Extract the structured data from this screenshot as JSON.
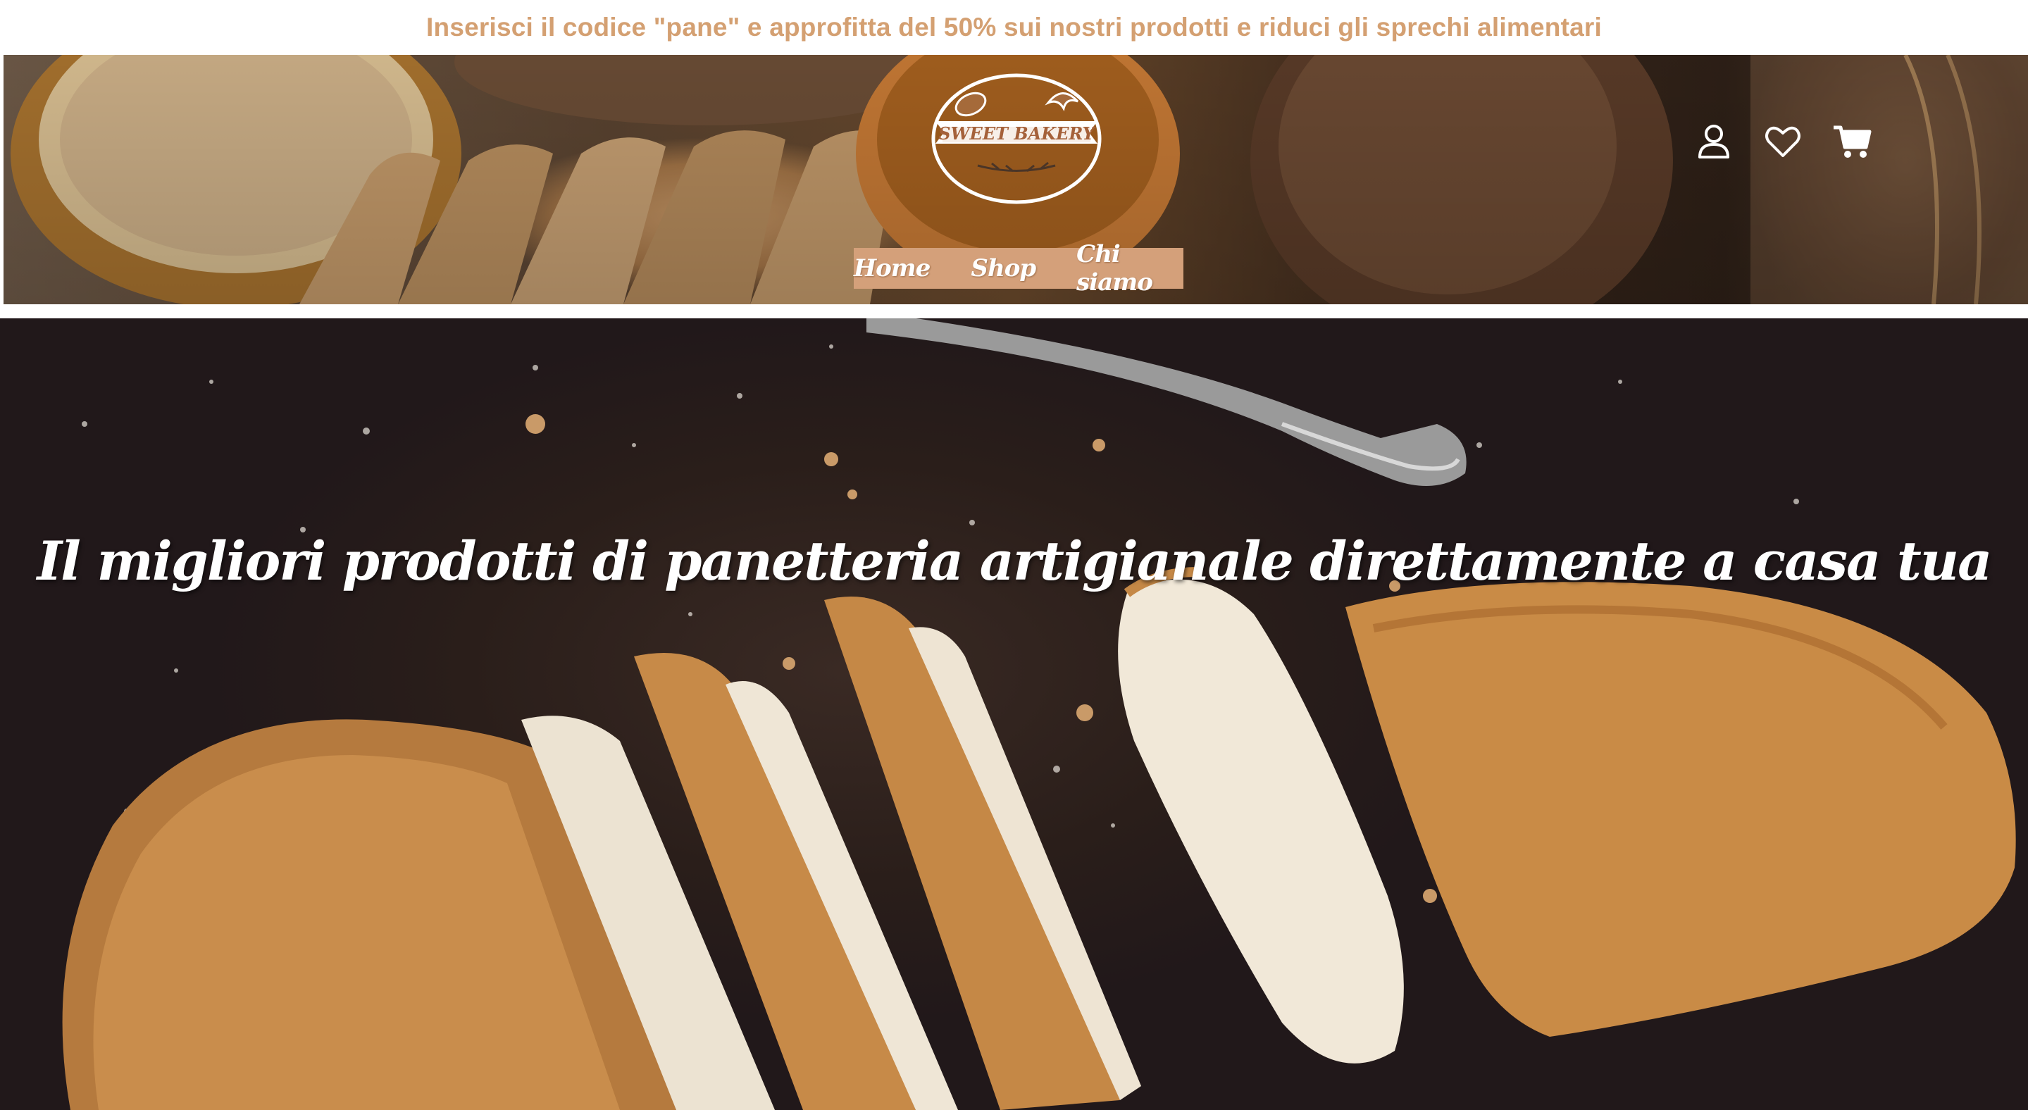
{
  "promo": {
    "text": "Inserisci il codice \"pane\" e approfitta del 50% sui nostri prodotti e riduci gli sprechi alimentari"
  },
  "header": {
    "logo_text": "SWEET BAKERY",
    "nav": [
      {
        "label": "Home"
      },
      {
        "label": "Shop"
      },
      {
        "label": "Chi siamo"
      }
    ],
    "icons": [
      "user-icon",
      "heart-icon",
      "cart-icon"
    ]
  },
  "hero": {
    "title": "Il migliori prodotti di panetteria artigianale direttamente a casa tua"
  },
  "colors": {
    "accent": "#d4a072",
    "nav_bg": "#d4a07a",
    "hero_bg": "#2a1e1a"
  }
}
